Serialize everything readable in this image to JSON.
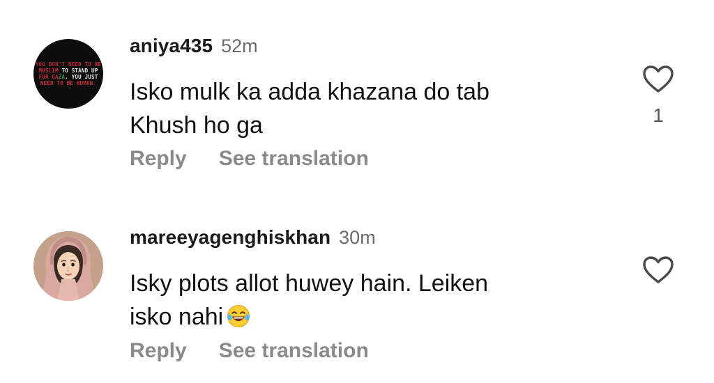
{
  "comments": [
    {
      "username": "aniya435",
      "time": "52m",
      "text_line1": "Isko mulk ka adda khazana do tab",
      "text_line2": "Khush ho ga",
      "like_count": "1",
      "reply_label": "Reply",
      "translate_label": "See translation",
      "avatar": {
        "line1": "YOU DON'T NEED TO BE",
        "line2a": "MUSLIM",
        "line2b": " TO STAND UP",
        "line3a": "FOR GA",
        "line3b": "ZA",
        "line3c": ". YOU JUST",
        "line4": "NEED TO BE HUMAN."
      }
    },
    {
      "username": "mareeyagenghiskhan",
      "time": "30m",
      "text_line1": "Isky plots allot huwey hain. Leiken",
      "text_line2": "isko nahi",
      "emoji": "laughing-with-tears-emoji",
      "reply_label": "Reply",
      "translate_label": "See translation"
    }
  ],
  "colors": {
    "username": "#1a1a1a",
    "meta_grey": "#6b6b6b",
    "action_grey": "#8a8a8a",
    "background": "#ffffff"
  }
}
